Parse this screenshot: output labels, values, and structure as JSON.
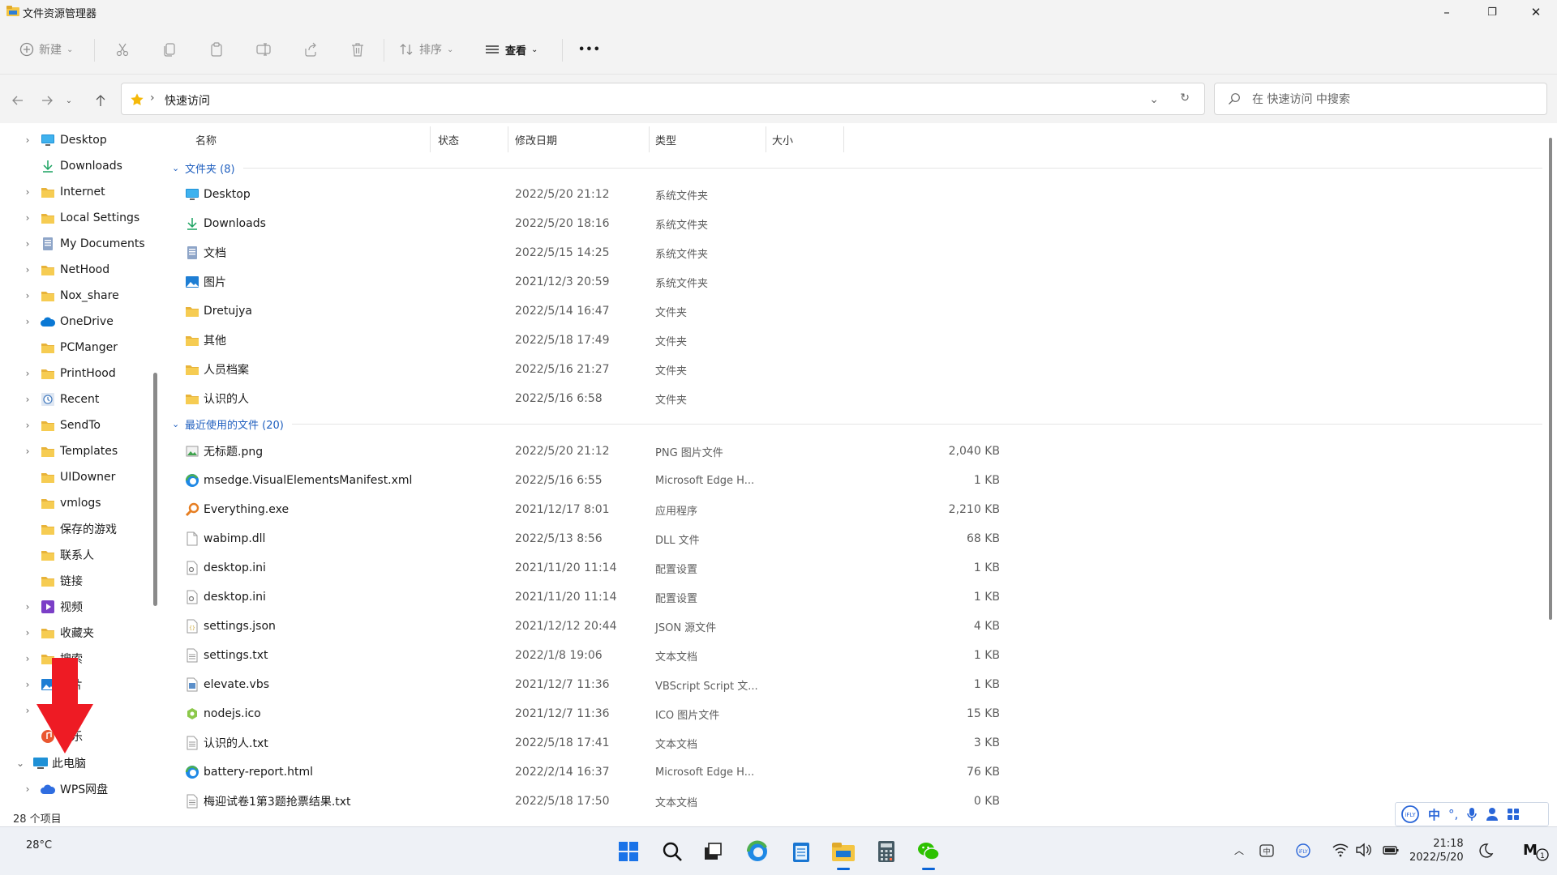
{
  "window": {
    "title": "文件资源管理器",
    "controls": {
      "minimize": "–",
      "maximize": "❐",
      "close": "✕"
    }
  },
  "toolbar": {
    "new_label": "新建",
    "sort_label": "排序",
    "view_label": "查看",
    "more_label": "•••"
  },
  "address": {
    "path": "快速访问",
    "search_placeholder": "在 快速访问 中搜索"
  },
  "sidebar": {
    "items": [
      {
        "label": "Desktop",
        "icon": "desktop-icon",
        "expandable": true
      },
      {
        "label": "Downloads",
        "icon": "download-icon",
        "expandable": false
      },
      {
        "label": "Internet",
        "icon": "folder-icon",
        "expandable": true
      },
      {
        "label": "Local Settings",
        "icon": "folder-icon",
        "expandable": true
      },
      {
        "label": "My Documents",
        "icon": "documents-icon",
        "expandable": true
      },
      {
        "label": "NetHood",
        "icon": "folder-icon",
        "expandable": true
      },
      {
        "label": "Nox_share",
        "icon": "folder-icon",
        "expandable": true
      },
      {
        "label": "OneDrive",
        "icon": "onedrive-icon",
        "expandable": true
      },
      {
        "label": "PCManger",
        "icon": "folder-icon",
        "expandable": false
      },
      {
        "label": "PrintHood",
        "icon": "folder-icon",
        "expandable": true
      },
      {
        "label": "Recent",
        "icon": "recent-icon",
        "expandable": true
      },
      {
        "label": "SendTo",
        "icon": "folder-icon",
        "expandable": true
      },
      {
        "label": "Templates",
        "icon": "folder-icon",
        "expandable": true
      },
      {
        "label": "UIDowner",
        "icon": "folder-icon",
        "expandable": false
      },
      {
        "label": "vmlogs",
        "icon": "folder-icon",
        "expandable": false
      },
      {
        "label": "保存的游戏",
        "icon": "folder-icon",
        "expandable": false
      },
      {
        "label": "联系人",
        "icon": "folder-icon",
        "expandable": false
      },
      {
        "label": "链接",
        "icon": "folder-icon",
        "expandable": false
      },
      {
        "label": "视频",
        "icon": "video-icon",
        "expandable": true
      },
      {
        "label": "收藏夹",
        "icon": "folder-icon",
        "expandable": true
      },
      {
        "label": "搜索",
        "icon": "folder-icon",
        "expandable": true
      },
      {
        "label": "图片",
        "icon": "pictures-icon",
        "expandable": true
      },
      {
        "label": "",
        "icon": "",
        "expandable": true
      },
      {
        "label": "音乐",
        "icon": "music-icon",
        "expandable": false
      },
      {
        "label": "此电脑",
        "icon": "pc-icon",
        "expandable": true
      },
      {
        "label": "WPS网盘",
        "icon": "wps-cloud-icon",
        "expandable": true
      }
    ]
  },
  "status": {
    "count": "28 个项目"
  },
  "columns": {
    "name": "名称",
    "status": "状态",
    "date": "修改日期",
    "type": "类型",
    "size": "大小"
  },
  "groups": {
    "folders": "文件夹 (8)",
    "recent": "最近使用的文件 (20)"
  },
  "folders": [
    {
      "name": "Desktop",
      "date": "2022/5/20 21:12",
      "type": "系统文件夹",
      "size": "",
      "icon": "desktop-icon"
    },
    {
      "name": "Downloads",
      "date": "2022/5/20 18:16",
      "type": "系统文件夹",
      "size": "",
      "icon": "download-icon"
    },
    {
      "name": "文档",
      "date": "2022/5/15 14:25",
      "type": "系统文件夹",
      "size": "",
      "icon": "documents-icon"
    },
    {
      "name": "图片",
      "date": "2021/12/3 20:59",
      "type": "系统文件夹",
      "size": "",
      "icon": "pictures-icon"
    },
    {
      "name": "Dretujya",
      "date": "2022/5/14 16:47",
      "type": "文件夹",
      "size": "",
      "icon": "folder-icon"
    },
    {
      "name": "其他",
      "date": "2022/5/18 17:49",
      "type": "文件夹",
      "size": "",
      "icon": "folder-icon"
    },
    {
      "name": "人员档案",
      "date": "2022/5/16 21:27",
      "type": "文件夹",
      "size": "",
      "icon": "folder-icon"
    },
    {
      "name": "认识的人",
      "date": "2022/5/16 6:58",
      "type": "文件夹",
      "size": "",
      "icon": "folder-icon"
    }
  ],
  "recent_files": [
    {
      "name": "无标题.png",
      "date": "2022/5/20 21:12",
      "type": "PNG 图片文件",
      "size": "2,040 KB",
      "icon": "image-file-icon"
    },
    {
      "name": "msedge.VisualElementsManifest.xml",
      "date": "2022/5/16 6:55",
      "type": "Microsoft Edge H...",
      "size": "1 KB",
      "icon": "edge-icon"
    },
    {
      "name": "Everything.exe",
      "date": "2021/12/17 8:01",
      "type": "应用程序",
      "size": "2,210 KB",
      "icon": "search-app-icon"
    },
    {
      "name": "wabimp.dll",
      "date": "2022/5/13 8:56",
      "type": "DLL 文件",
      "size": "68 KB",
      "icon": "file-icon"
    },
    {
      "name": "desktop.ini",
      "date": "2021/11/20 11:14",
      "type": "配置设置",
      "size": "1 KB",
      "icon": "settings-file-icon"
    },
    {
      "name": "desktop.ini",
      "date": "2021/11/20 11:14",
      "type": "配置设置",
      "size": "1 KB",
      "icon": "settings-file-icon"
    },
    {
      "name": "settings.json",
      "date": "2021/12/12 20:44",
      "type": "JSON 源文件",
      "size": "4 KB",
      "icon": "json-file-icon"
    },
    {
      "name": "settings.txt",
      "date": "2022/1/8 19:06",
      "type": "文本文档",
      "size": "1 KB",
      "icon": "text-file-icon"
    },
    {
      "name": "elevate.vbs",
      "date": "2021/12/7 11:36",
      "type": "VBScript Script 文...",
      "size": "1 KB",
      "icon": "script-file-icon"
    },
    {
      "name": "nodejs.ico",
      "date": "2021/12/7 11:36",
      "type": "ICO 图片文件",
      "size": "15 KB",
      "icon": "nodejs-icon"
    },
    {
      "name": "认识的人.txt",
      "date": "2022/5/18 17:41",
      "type": "文本文档",
      "size": "3 KB",
      "icon": "text-file-icon"
    },
    {
      "name": "battery-report.html",
      "date": "2022/2/14 16:37",
      "type": "Microsoft Edge H...",
      "size": "76 KB",
      "icon": "edge-icon"
    },
    {
      "name": "梅迎试卷1第3题抢票结果.txt",
      "date": "2022/5/18 17:50",
      "type": "文本文档",
      "size": "0 KB",
      "icon": "text-file-icon"
    }
  ],
  "taskbar": {
    "weather": "28°C",
    "clock_time": "21:18",
    "clock_date": "2022/5/20",
    "apps": [
      "start-icon",
      "search-icon",
      "task-view-icon",
      "edge-icon",
      "notepad-icon",
      "file-explorer-icon",
      "calculator-icon",
      "wechat-icon"
    ]
  },
  "ime": {
    "lang": "中",
    "punct": "°,"
  },
  "colors": {
    "accent": "#1f5fbf",
    "folder": "#f4c542",
    "arrow": "#ee1b24",
    "taskbar": "#eef1f6"
  }
}
